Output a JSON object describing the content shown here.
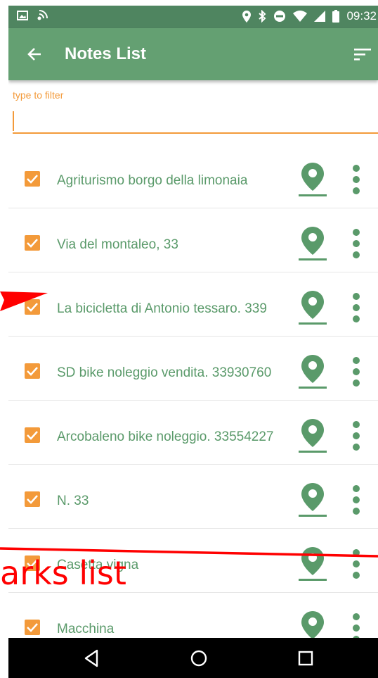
{
  "status_bar": {
    "time": "09:32"
  },
  "app_bar": {
    "title": "Notes List"
  },
  "filter": {
    "label": "type to filter",
    "value": ""
  },
  "notes": [
    {
      "label": "Agriturismo borgo della limonaia",
      "checked": true
    },
    {
      "label": "Via del montaleo, 33",
      "checked": true
    },
    {
      "label": "La bicicletta di Antonio tessaro. 339",
      "checked": true
    },
    {
      "label": "SD bike noleggio vendita. 33930760",
      "checked": true
    },
    {
      "label": "Arcobaleno bike noleggio. 33554227",
      "checked": true
    },
    {
      "label": "N. 33",
      "checked": true
    },
    {
      "label": "Casetta vigna",
      "checked": true
    },
    {
      "label": "Macchina",
      "checked": true
    }
  ],
  "annotation": {
    "text": "arks list"
  },
  "colors": {
    "status_bar": "#4f8560",
    "app_bar": "#64a072",
    "accent": "#f39a3a",
    "item_text": "#5a9a6a",
    "pin": "#5a9a6a",
    "annotation": "#ff0000"
  },
  "icons": [
    "back-arrow-icon",
    "sort-icon",
    "checkbox-checked-icon",
    "map-pin-icon",
    "more-vert-icon",
    "nav-back-icon",
    "nav-home-icon",
    "nav-recents-icon"
  ]
}
